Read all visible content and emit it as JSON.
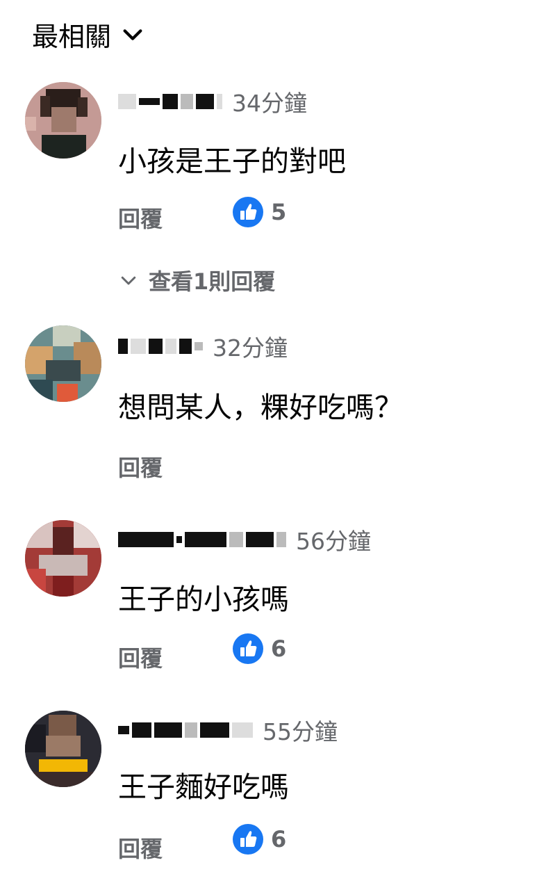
{
  "sort": {
    "label": "最相關",
    "icon": "chevron-down-icon"
  },
  "comments": [
    {
      "time": "34分鐘",
      "text": "小孩是王子的對吧",
      "reply": "回覆",
      "likes": "5",
      "view_replies": "查看1則回覆"
    },
    {
      "time": "32分鐘",
      "text": "想問某人，粿好吃嗎？",
      "reply": "回覆"
    },
    {
      "time": "56分鐘",
      "text": "王子的小孩嗎",
      "reply": "回覆",
      "likes": "6"
    },
    {
      "time": "55分鐘",
      "text": "王子麵好吃嗎",
      "reply": "回覆",
      "likes": "6"
    }
  ],
  "colors": {
    "like_blue": "#1877f2",
    "secondary_text": "#65676b",
    "primary_text": "#050505"
  }
}
